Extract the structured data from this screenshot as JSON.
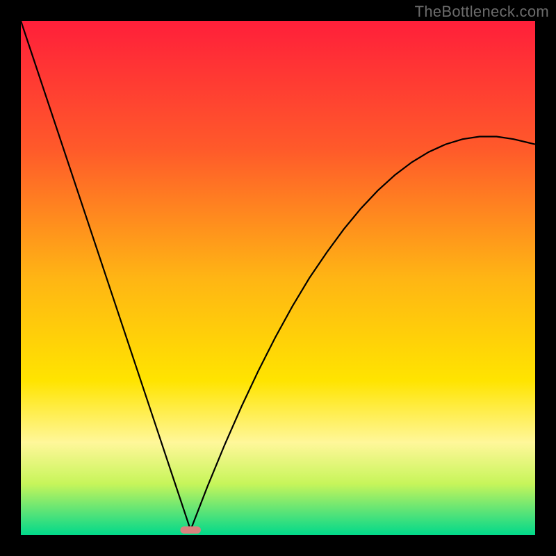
{
  "watermark": "TheBottleneck.com",
  "chart_data": {
    "type": "line",
    "title": "",
    "xlabel": "",
    "ylabel": "",
    "xlim": [
      0,
      100
    ],
    "ylim": [
      0,
      100
    ],
    "background": {
      "type": "vertical-gradient",
      "stops": [
        {
          "offset": 0.0,
          "color": "#ff1f3a"
        },
        {
          "offset": 0.25,
          "color": "#ff5a2a"
        },
        {
          "offset": 0.5,
          "color": "#ffb514"
        },
        {
          "offset": 0.7,
          "color": "#ffe400"
        },
        {
          "offset": 0.82,
          "color": "#fff79a"
        },
        {
          "offset": 0.9,
          "color": "#c7f55a"
        },
        {
          "offset": 0.96,
          "color": "#4fe27a"
        },
        {
          "offset": 1.0,
          "color": "#00d98a"
        }
      ]
    },
    "marker": {
      "shape": "rounded-hline",
      "x": 33.0,
      "y": 1.0,
      "width": 4.0,
      "height": 1.4,
      "color": "#d9827e"
    },
    "series": [
      {
        "name": "bottleneck-curve",
        "color": "#000000",
        "stroke_width": 2.2,
        "x": [
          0.0,
          3.3,
          6.6,
          9.9,
          13.2,
          16.5,
          19.8,
          23.1,
          26.4,
          29.7,
          33.0,
          36.3,
          39.6,
          42.9,
          46.2,
          49.5,
          52.8,
          56.1,
          59.5,
          62.8,
          66.1,
          69.4,
          72.7,
          76.0,
          79.3,
          82.6,
          85.9,
          89.2,
          92.5,
          95.8,
          100.0
        ],
        "y": [
          100.0,
          90.1,
          80.2,
          70.3,
          60.4,
          50.5,
          40.6,
          30.7,
          20.8,
          10.9,
          1.0,
          9.5,
          17.5,
          25.0,
          32.0,
          38.5,
          44.5,
          50.0,
          55.0,
          59.5,
          63.5,
          67.0,
          70.0,
          72.5,
          74.5,
          76.0,
          77.0,
          77.5,
          77.5,
          77.0,
          76.0
        ]
      }
    ]
  }
}
